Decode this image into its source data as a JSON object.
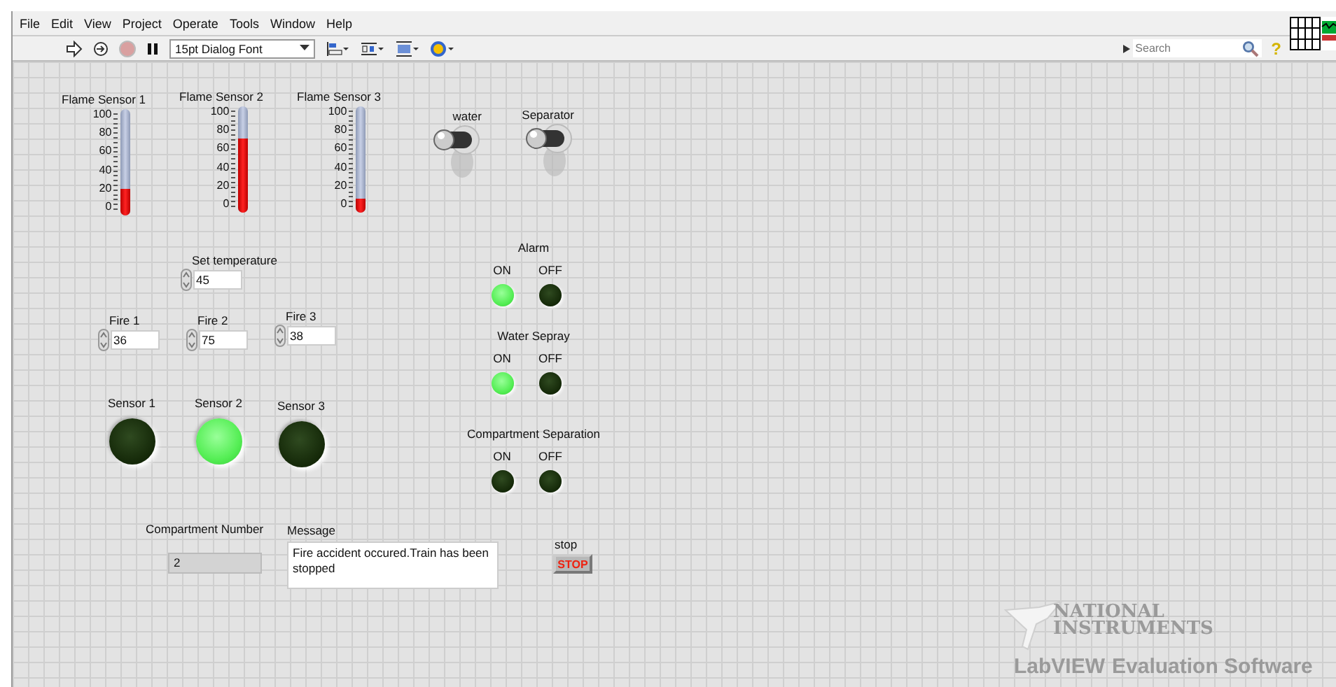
{
  "menu": [
    "File",
    "Edit",
    "View",
    "Project",
    "Operate",
    "Tools",
    "Window",
    "Help"
  ],
  "toolbar": {
    "font": "15pt Dialog Font",
    "search": {
      "placeholder": "Search"
    },
    "help": "?"
  },
  "thermometers": [
    {
      "label": "Flame Sensor 1",
      "level": 0.25,
      "ticks": [
        "100",
        "80",
        "60",
        "40",
        "20",
        "0"
      ]
    },
    {
      "label": "Flame Sensor 2",
      "level": 0.7,
      "ticks": [
        "100",
        "80",
        "60",
        "40",
        "20",
        "0"
      ]
    },
    {
      "label": "Flame Sensor 3",
      "level": 0.13,
      "ticks": [
        "100",
        "80",
        "60",
        "40",
        "20",
        "0"
      ]
    }
  ],
  "switches": [
    {
      "label": "water",
      "on": false
    },
    {
      "label": "Separator",
      "on": false
    }
  ],
  "set_temperature": {
    "label": "Set temperature",
    "value": "45"
  },
  "fires": [
    {
      "label": "Fire 1",
      "value": "36"
    },
    {
      "label": "Fire 2",
      "value": "75"
    },
    {
      "label": "Fire 3",
      "value": "38"
    }
  ],
  "sensors": [
    {
      "label": "Sensor 1",
      "on": false
    },
    {
      "label": "Sensor 2",
      "on": true
    },
    {
      "label": "Sensor 3",
      "on": false
    }
  ],
  "indicator_groups": [
    {
      "title": "Alarm",
      "lights": [
        {
          "label": "ON",
          "on": true
        },
        {
          "label": "OFF",
          "on": false
        }
      ]
    },
    {
      "title": "Water Sepray",
      "lights": [
        {
          "label": "ON",
          "on": true
        },
        {
          "label": "OFF",
          "on": false
        }
      ]
    },
    {
      "title": "Compartment Separation",
      "lights": [
        {
          "label": "ON",
          "on": false
        },
        {
          "label": "OFF",
          "on": false
        }
      ]
    }
  ],
  "compartment_number": {
    "label": "Compartment Number",
    "value": "2"
  },
  "message": {
    "label": "Message",
    "value": "Fire accident occured.Train has been stopped"
  },
  "stop": {
    "label": "stop",
    "button": "STOP"
  },
  "watermark": {
    "lines": [
      "NATIONAL",
      "INSTRUMENTS",
      "LabVIEW",
      "Evaluation Software"
    ]
  }
}
